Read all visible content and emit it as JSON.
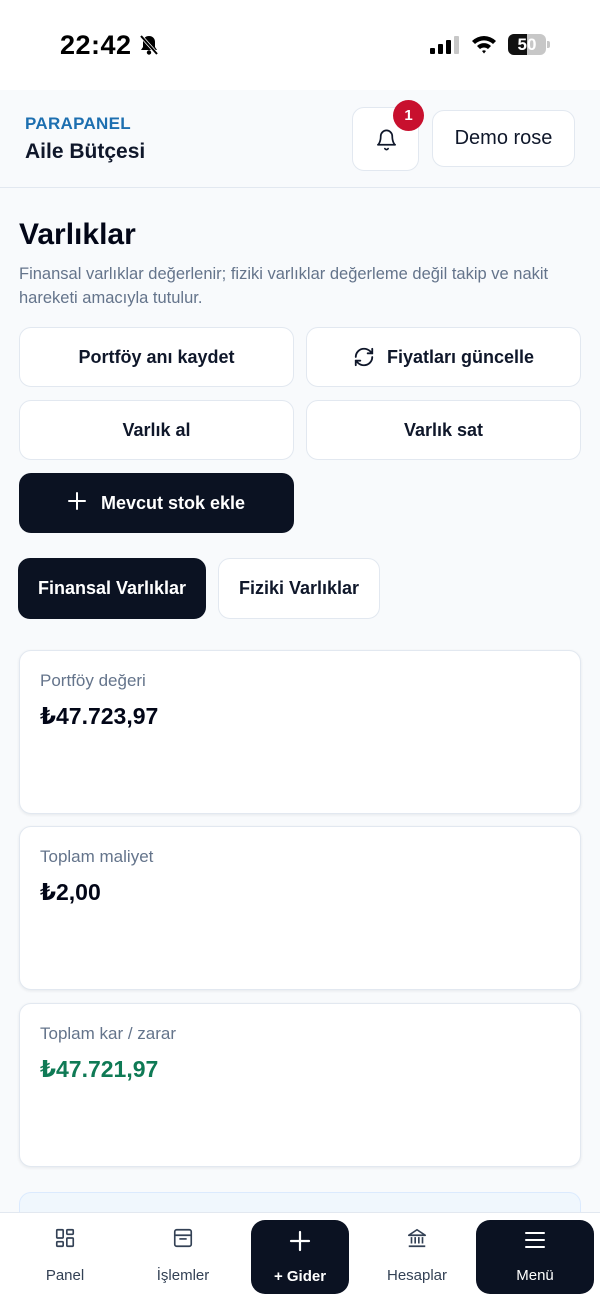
{
  "status_bar": {
    "time": "22:42",
    "battery": "50",
    "battery_level": 0.5
  },
  "header": {
    "brand": "PARAPANEL",
    "workspace": "Aile Bütçesi",
    "notification_count": "1",
    "user_name": "Demo rose"
  },
  "page": {
    "title": "Varlıklar",
    "description": "Finansal varlıklar değerlenir; fiziki varlıklar değerleme değil takip ve nakit hareketi amacıyla tutulur."
  },
  "actions": {
    "snapshot": "Portföy anı kaydet",
    "refresh_prices": "Fiyatları güncelle",
    "buy": "Varlık al",
    "sell": "Varlık sat",
    "add_stock": "Mevcut stok ekle"
  },
  "tabs": [
    {
      "label": "Finansal Varlıklar",
      "active": true
    },
    {
      "label": "Fiziki Varlıklar",
      "active": false
    }
  ],
  "cards": [
    {
      "label": "Portföy değeri",
      "value": "₺47.723,97"
    },
    {
      "label": "Toplam maliyet",
      "value": "₺2,00"
    },
    {
      "label": "Toplam kar / zarar",
      "value": "₺47.721,97"
    }
  ],
  "bottom_nav": {
    "panel": "Panel",
    "transactions": "İşlemler",
    "add_expense": "+ Gider",
    "accounts": "Hesaplar",
    "menu": "Menü"
  },
  "colors": {
    "brand": "#1d6fb0",
    "primary_dark": "#0b1222",
    "badge": "#c8102e",
    "profit": "#0f7a55"
  }
}
